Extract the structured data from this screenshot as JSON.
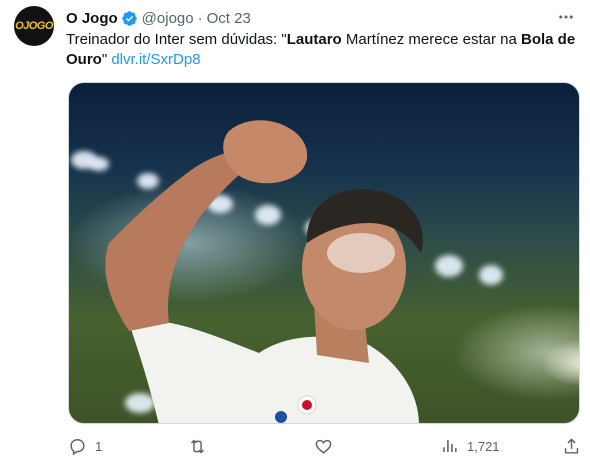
{
  "author": {
    "avatar_text": "OJOGO",
    "name": "O Jogo",
    "handle": "@ojogo",
    "separator": "·",
    "date": "Oct 23"
  },
  "tweet": {
    "text_1": "Treinador do Inter sem dúvidas: \"",
    "bold_1": "Lautaro",
    "text_2": " Martínez merece estar na ",
    "bold_2": "Bola de Ouro",
    "text_3": "\" ",
    "link": "dlvr.it/SxrDp8"
  },
  "media": {
    "alt_icon": "photo-football-player-celebrating"
  },
  "actions": {
    "reply_icon": "reply-icon",
    "reply_count": "1",
    "retweet_icon": "retweet-icon",
    "retweet_count": "",
    "like_icon": "heart-icon",
    "like_count": "",
    "views_icon": "views-icon",
    "views_count": "1,721",
    "share_icon": "share-icon"
  },
  "colors": {
    "link": "#1d9bf0",
    "muted": "#536471",
    "verified": "#1d9bf0"
  }
}
